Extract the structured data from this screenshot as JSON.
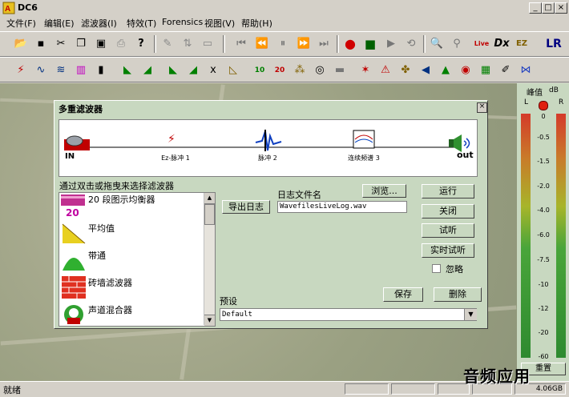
{
  "window": {
    "title": "DC6"
  },
  "menu": [
    "文件(F)",
    "编辑(E)",
    "滤波器(I)",
    "特效(T)",
    "Forensics",
    "视图(V)",
    "帮助(H)"
  ],
  "toolbar1_icons": [
    "open-icon",
    "save-icon",
    "cut-icon",
    "copy-icon",
    "paste-icon",
    "print-icon",
    "help-icon",
    "pencil-icon",
    "level-icon",
    "screen-icon",
    "skip-start-icon",
    "rewind-icon",
    "pause-icon",
    "forward-icon",
    "skip-end-icon",
    "record-icon",
    "stop-icon",
    "play-icon",
    "loop-icon",
    "zoom-icon",
    "zoom-tools-icon",
    "live-icon",
    "dx-icon",
    "ez-icon",
    "lr-icon"
  ],
  "toolbar2_icons": [
    "filter1-icon",
    "filter2-icon",
    "filter3-icon",
    "filter4-icon",
    "filter5-icon",
    "filter6-icon",
    "filter7-icon",
    "filter8-icon",
    "filter9-icon",
    "filter10-icon",
    "filter11-icon",
    "eq10-icon",
    "eq20-icon",
    "filter14-icon",
    "filter15-icon",
    "filter16-icon",
    "filter17-icon",
    "filter18-icon",
    "filter19-icon",
    "filter20-icon",
    "filter21-icon",
    "filter22-icon",
    "filter23-icon",
    "filter24-icon",
    "filter25-icon"
  ],
  "toolbar2_labels": {
    "eq10": "10",
    "eq20": "20"
  },
  "dialog": {
    "title": "多重滤波器",
    "chain": {
      "in": "IN",
      "out": "out",
      "f1": "Ez-脉冲 1",
      "f2": "脉冲 2",
      "f3": "连续频谱 3"
    },
    "list_hint": "通过双击或拖曳来选择滤波器",
    "filters": [
      {
        "label": "20 段图示均衡器",
        "badge": "20"
      },
      {
        "label": "平均值"
      },
      {
        "label": "带通"
      },
      {
        "label": "砖墙滤波器"
      },
      {
        "label": "声道混合器"
      }
    ],
    "log_label": "日志文件名",
    "browse": "浏览...",
    "export_log": "导出日志",
    "log_value": "WavefilesLiveLog.wav",
    "run": "运行",
    "close": "关闭",
    "preview": "试听",
    "realtime_preview": "实时试听",
    "ignore": "忽略",
    "save": "保存",
    "delete": "删除",
    "preset_label": "预设",
    "preset_value": "Default"
  },
  "meter": {
    "title": "峰值",
    "unit": "dB",
    "left": "L",
    "right": "R",
    "ticks": [
      "0",
      "-0.5",
      "-1.5",
      "-2.0",
      "-4.0",
      "-6.0",
      "-7.5",
      "-10",
      "-12",
      "-20",
      "-60"
    ],
    "reset": "重置"
  },
  "status": {
    "left": "就绪",
    "disk": "4.06GB"
  },
  "watermark": "音频应用",
  "colors": {
    "dialog_bg": "#c8d8c0",
    "meter_top": "#d43a2a",
    "meter_bottom": "#2e8a30"
  }
}
